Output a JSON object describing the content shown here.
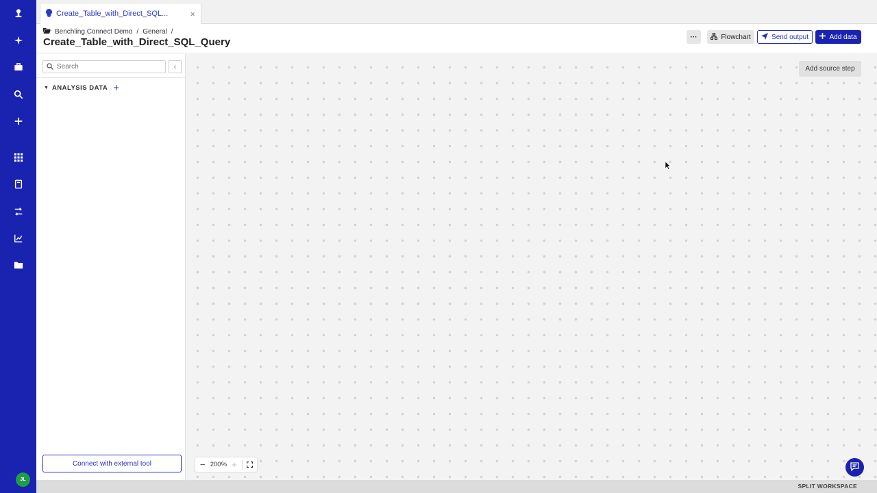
{
  "tab": {
    "title": "Create_Table_with_Direct_SQL...",
    "close": "×"
  },
  "breadcrumb": {
    "project": "Benchling Connect Demo",
    "folder": "General",
    "separator": "/"
  },
  "page_title": "Create_Table_with_Direct_SQL_Query",
  "toolbar": {
    "more": "···",
    "flowchart": "Flowchart",
    "send_output": "Send output",
    "add_data": "Add data"
  },
  "search": {
    "placeholder": "Search"
  },
  "panel": {
    "collapse": "‹",
    "section_label": "ANALYSIS DATA",
    "section_add": "+",
    "connect_button": "Connect with external tool"
  },
  "canvas": {
    "add_source_step": "Add source step"
  },
  "zoom": {
    "minus": "−",
    "value": "200%",
    "plus": "+"
  },
  "rail": {
    "avatar_initials": "JL",
    "icons": [
      "benchling-logo-icon",
      "sparkle-icon",
      "briefcase-icon",
      "search-icon",
      "plus-icon",
      "apps-grid-icon",
      "notebook-icon",
      "workflow-icon",
      "chart-icon",
      "folder-icon"
    ]
  },
  "footer": {
    "split_workspace": "SPLIT WORKSPACE"
  },
  "colors": {
    "brand": "#1a23b0",
    "accent": "#2431c0",
    "avatar": "#1f9c4a"
  }
}
